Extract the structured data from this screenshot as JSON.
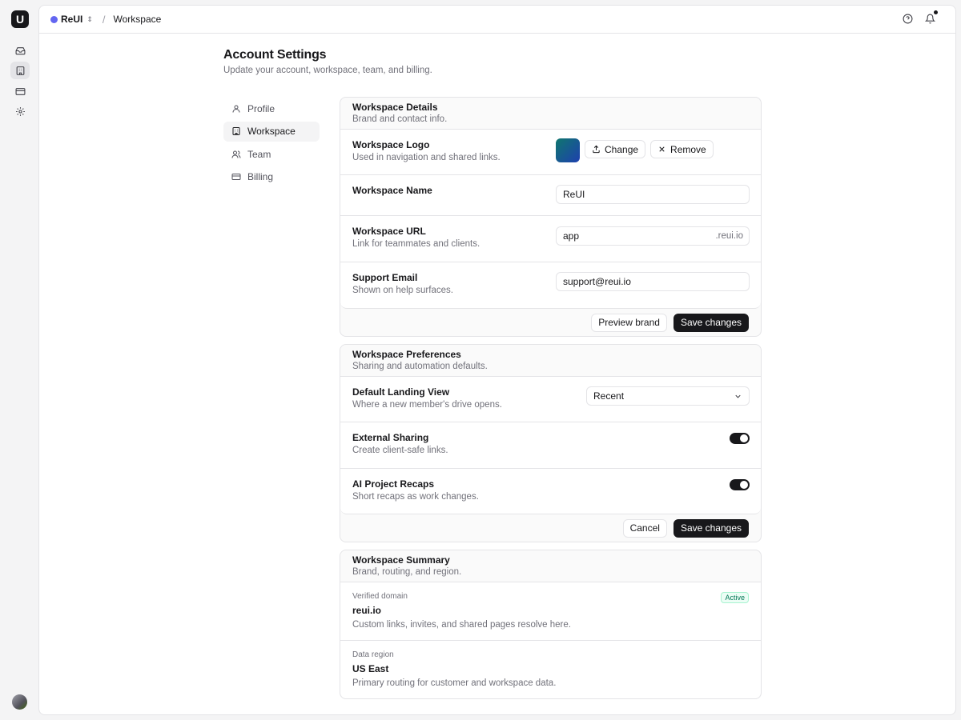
{
  "app": {
    "logo_letter": "U"
  },
  "topbar": {
    "workspace_name": "ReUI",
    "breadcrumb_sep": "/",
    "breadcrumb_current": "Workspace"
  },
  "page": {
    "title": "Account Settings",
    "subtitle": "Update your account, workspace, team, and billing."
  },
  "nav": {
    "items": [
      {
        "label": "Profile",
        "icon": "user-icon"
      },
      {
        "label": "Workspace",
        "icon": "building-icon",
        "active": true
      },
      {
        "label": "Team",
        "icon": "users-icon"
      },
      {
        "label": "Billing",
        "icon": "credit-card-icon"
      }
    ]
  },
  "details": {
    "title": "Workspace Details",
    "desc": "Brand and contact info.",
    "logo_label": "Workspace Logo",
    "logo_help": "Used in navigation and shared links.",
    "change_label": "Change",
    "remove_label": "Remove",
    "name_label": "Workspace Name",
    "name_value": "ReUI",
    "url_label": "Workspace URL",
    "url_help": "Link for teammates and clients.",
    "url_value": "app",
    "url_suffix": ".reui.io",
    "email_label": "Support Email",
    "email_help": "Shown on help surfaces.",
    "email_value": "support@reui.io",
    "preview_label": "Preview brand",
    "save_label": "Save changes"
  },
  "prefs": {
    "title": "Workspace Preferences",
    "desc": "Sharing and automation defaults.",
    "landing_label": "Default Landing View",
    "landing_help": "Where a new member's drive opens.",
    "landing_value": "Recent",
    "sharing_label": "External Sharing",
    "sharing_help": "Create client-safe links.",
    "sharing_on": true,
    "recaps_label": "AI Project Recaps",
    "recaps_help": "Short recaps as work changes.",
    "recaps_on": true,
    "cancel_label": "Cancel",
    "save_label": "Save changes"
  },
  "summary": {
    "title": "Workspace Summary",
    "desc": "Brand, routing, and region.",
    "domain_label": "Verified domain",
    "domain_badge": "Active",
    "domain_value": "reui.io",
    "domain_text": "Custom links, invites, and shared pages resolve here.",
    "region_label": "Data region",
    "region_value": "US East",
    "region_text": "Primary routing for customer and workspace data."
  },
  "colors": {
    "accent": "#18181b",
    "workspace_dot": "#6366f1",
    "badge_green": "#047857"
  }
}
